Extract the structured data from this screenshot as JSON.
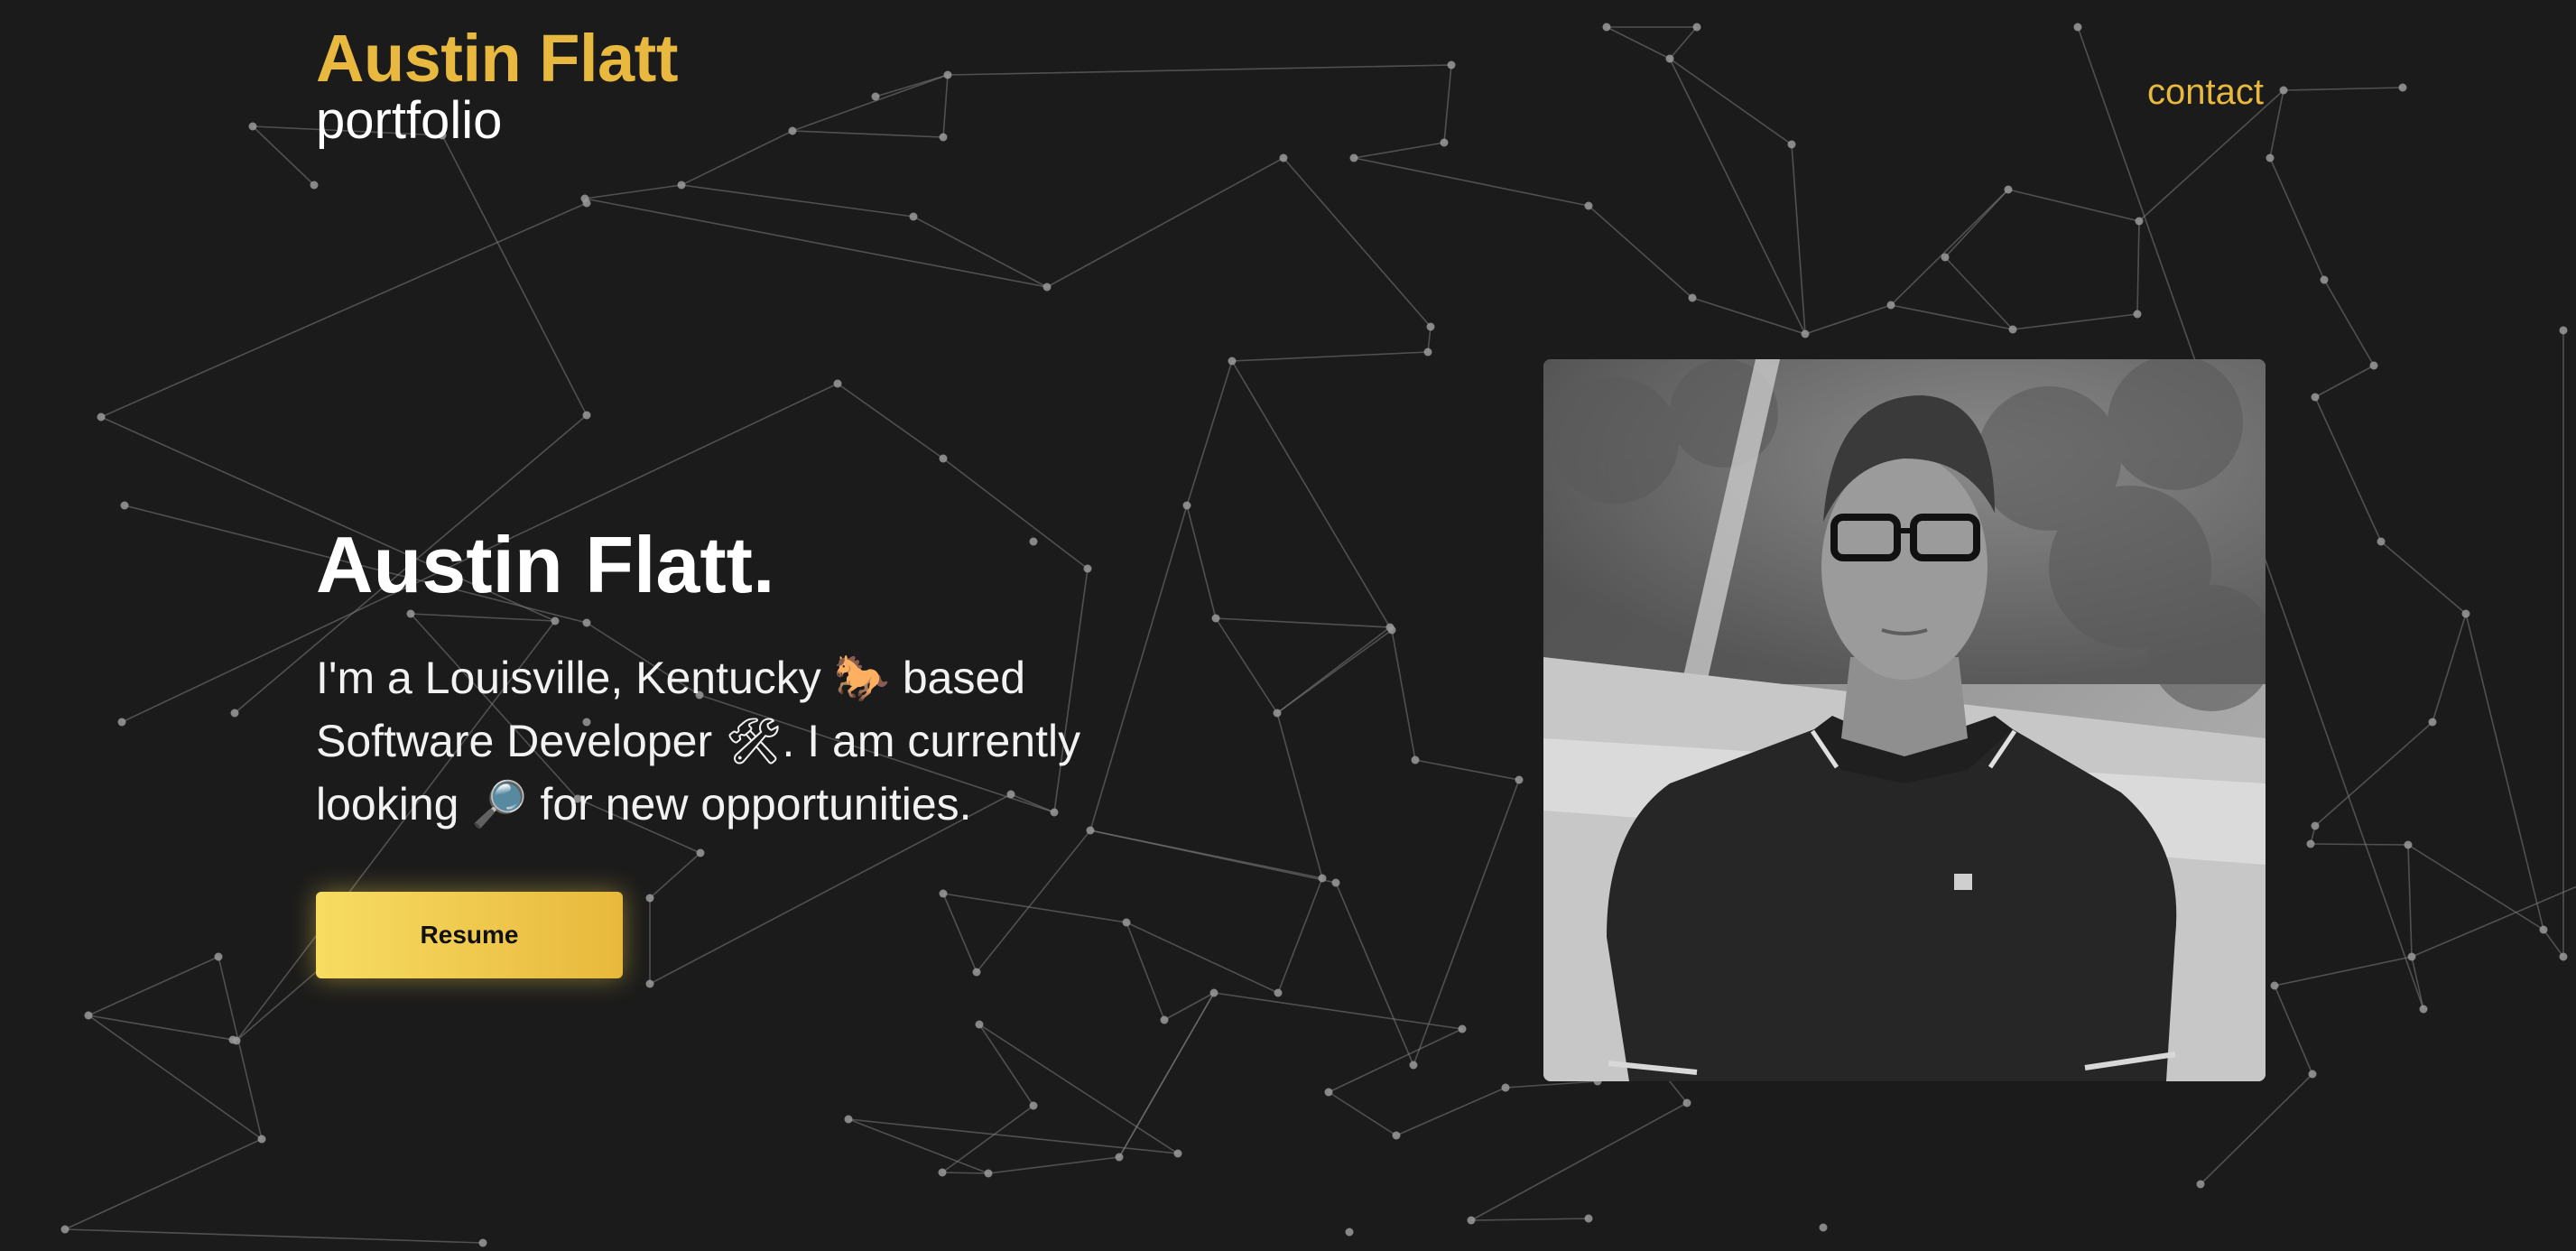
{
  "header": {
    "name": "Austin Flatt",
    "subtitle": "portfolio"
  },
  "nav": {
    "contact_label": "contact"
  },
  "hero": {
    "title": "Austin Flatt.",
    "description": "I'm a Louisville, Kentucky 🐎 based Software Developer 🛠. I am currently looking 🔎 for new opportunities.",
    "resume_label": "Resume"
  },
  "colors": {
    "background": "#1b1b1b",
    "accent": "#e8b93e",
    "button_gradient_start": "#f7dc62",
    "button_gradient_end": "#e8b83c",
    "text": "#ffffff"
  },
  "icons": [
    "horse-emoji-icon",
    "tools-emoji-icon",
    "magnifier-emoji-icon"
  ],
  "portrait": {
    "icon": "profile-photo",
    "style": "grayscale"
  }
}
